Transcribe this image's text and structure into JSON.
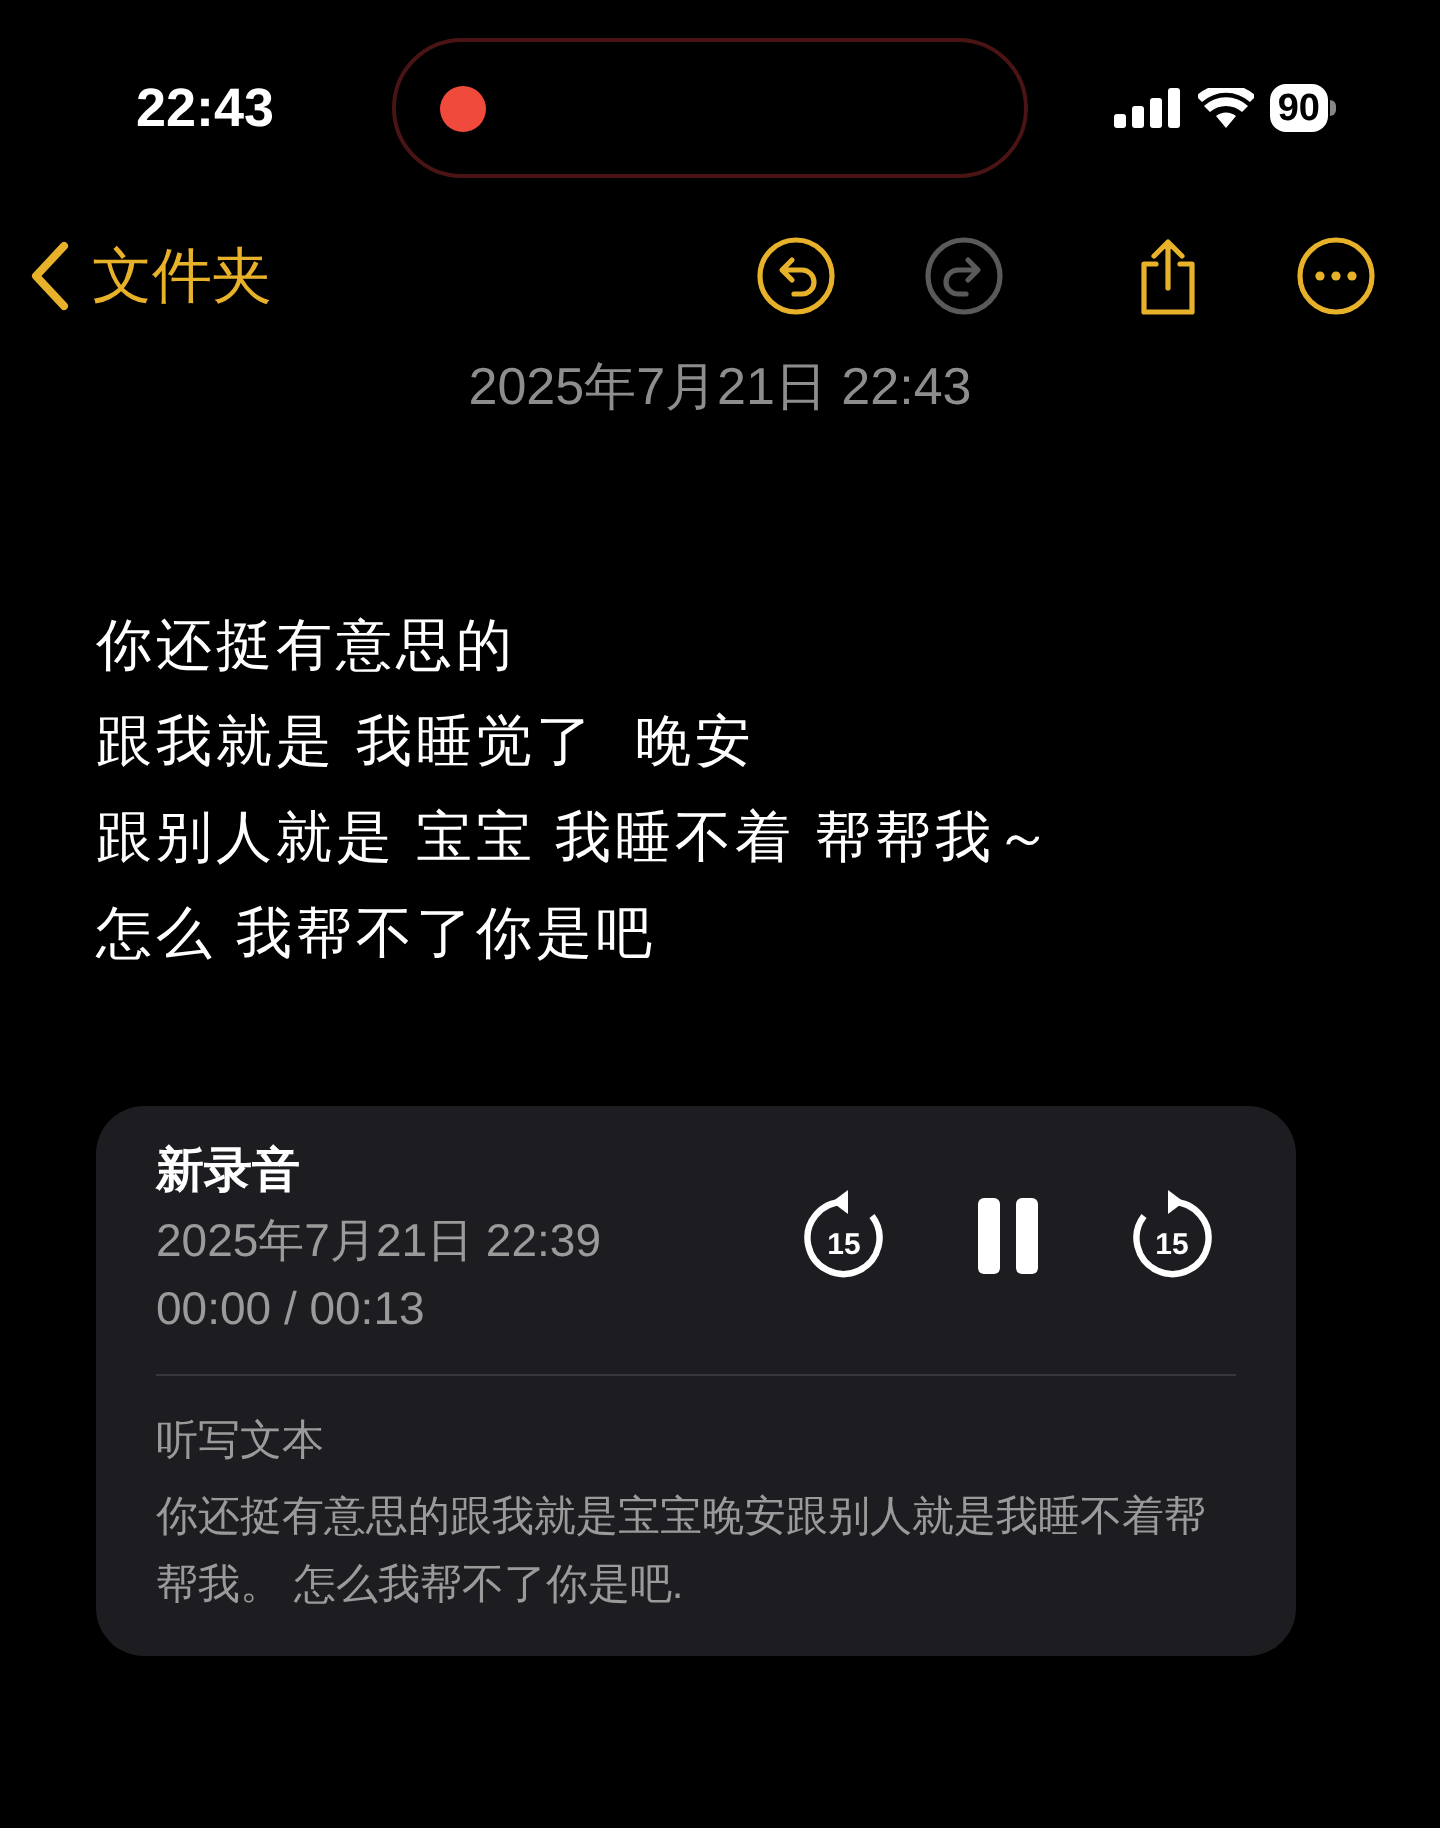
{
  "status_bar": {
    "time": "22:43",
    "recording": true,
    "battery": "90"
  },
  "toolbar": {
    "back_label": "文件夹",
    "buttons": [
      {
        "kind": "undo",
        "disabled": false
      },
      {
        "kind": "redo",
        "disabled": true
      },
      {
        "kind": "share",
        "disabled": false
      },
      {
        "kind": "more",
        "disabled": false
      }
    ]
  },
  "note": {
    "date": "2025年7月21日 22:43",
    "lines": [
      "你还挺有意思的",
      "跟我就是 我睡觉了  晚安",
      "跟别人就是 宝宝 我睡不着 帮帮我～",
      "怎么 我帮不了你是吧"
    ]
  },
  "recording": {
    "title": "新录音",
    "date": "2025年7月21日 22:39",
    "progress": "00:00 / 00:13",
    "controls": [
      {
        "kind": "skip_back",
        "label": "15"
      },
      {
        "kind": "pause"
      },
      {
        "kind": "skip_forward",
        "label": "15"
      }
    ],
    "transcript_label": "听写文本",
    "transcript": "你还挺有意思的跟我就是宝宝晚安跟别人就是我睡不着帮帮我。 怎么我帮不了你是吧."
  }
}
